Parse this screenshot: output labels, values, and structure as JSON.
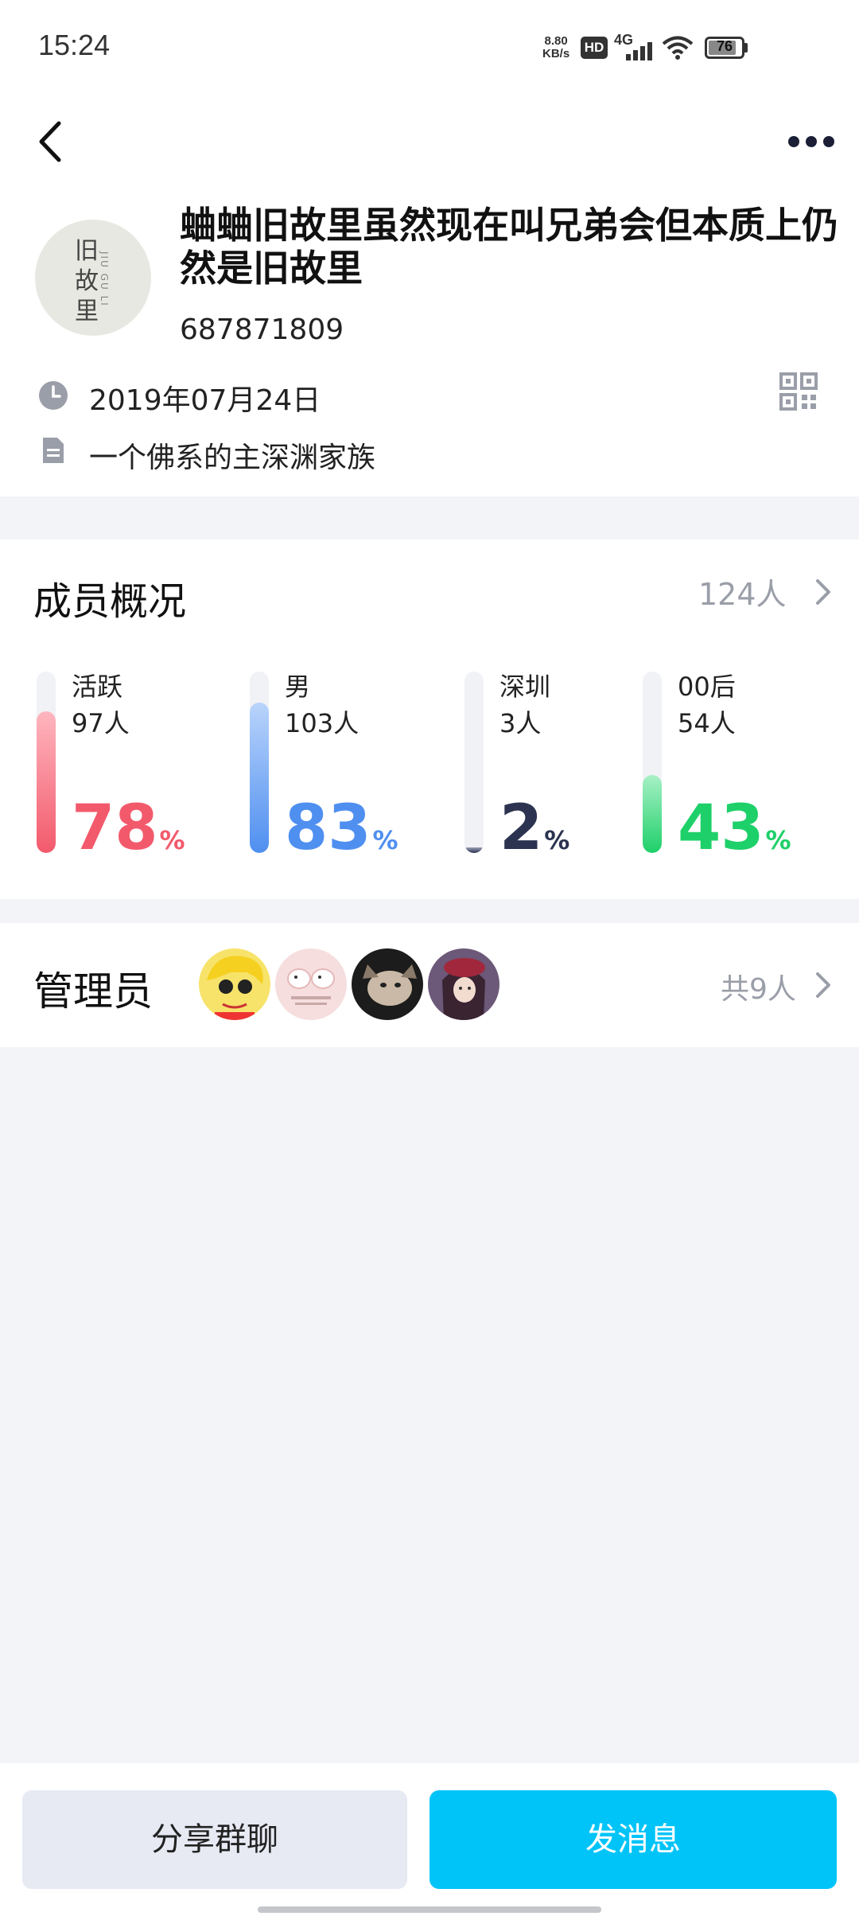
{
  "status_bar": {
    "time": "15:24",
    "net_speed_value": "8.80",
    "net_speed_unit": "KB/s",
    "hd": "HD",
    "network": "4G",
    "battery": "76"
  },
  "group": {
    "avatar_text": [
      "旧",
      "故",
      "里"
    ],
    "avatar_small": "JIU GU LI",
    "name": "蛐蛐旧故里虽然现在叫兄弟会但本质上仍然是旧故里",
    "id": "687871809",
    "created_date": "2019年07月24日",
    "description": "一个佛系的主深渊家族"
  },
  "members": {
    "title": "成员概况",
    "total": "124人",
    "stats": [
      {
        "label": "活跃",
        "count": "97人",
        "percent": 78,
        "unit": "%",
        "color": "#f25a6c",
        "color_light": "#ffb6bf"
      },
      {
        "label": "男",
        "count": "103人",
        "percent": 83,
        "unit": "%",
        "color": "#4f8ff0",
        "color_light": "#b9d4fb"
      },
      {
        "label": "深圳",
        "count": "3人",
        "percent": 2,
        "unit": "%",
        "color": "#2b3350",
        "color_light": "#9aa0b5"
      },
      {
        "label": "00后",
        "count": "54人",
        "percent": 43,
        "unit": "%",
        "color": "#1ed069",
        "color_light": "#a8f0c6"
      }
    ]
  },
  "admins": {
    "title": "管理员",
    "total": "共9人",
    "avatars": [
      "avatar-yellow-cartoon",
      "avatar-pink-hamsters",
      "avatar-cat-photo",
      "avatar-anime-girl"
    ]
  },
  "actions": {
    "share_label": "分享群聊",
    "send_label": "发消息"
  },
  "colors": {
    "accent": "#00c4f8",
    "secondary_button": "#e7e9f3",
    "background": "#f3f4f8"
  }
}
